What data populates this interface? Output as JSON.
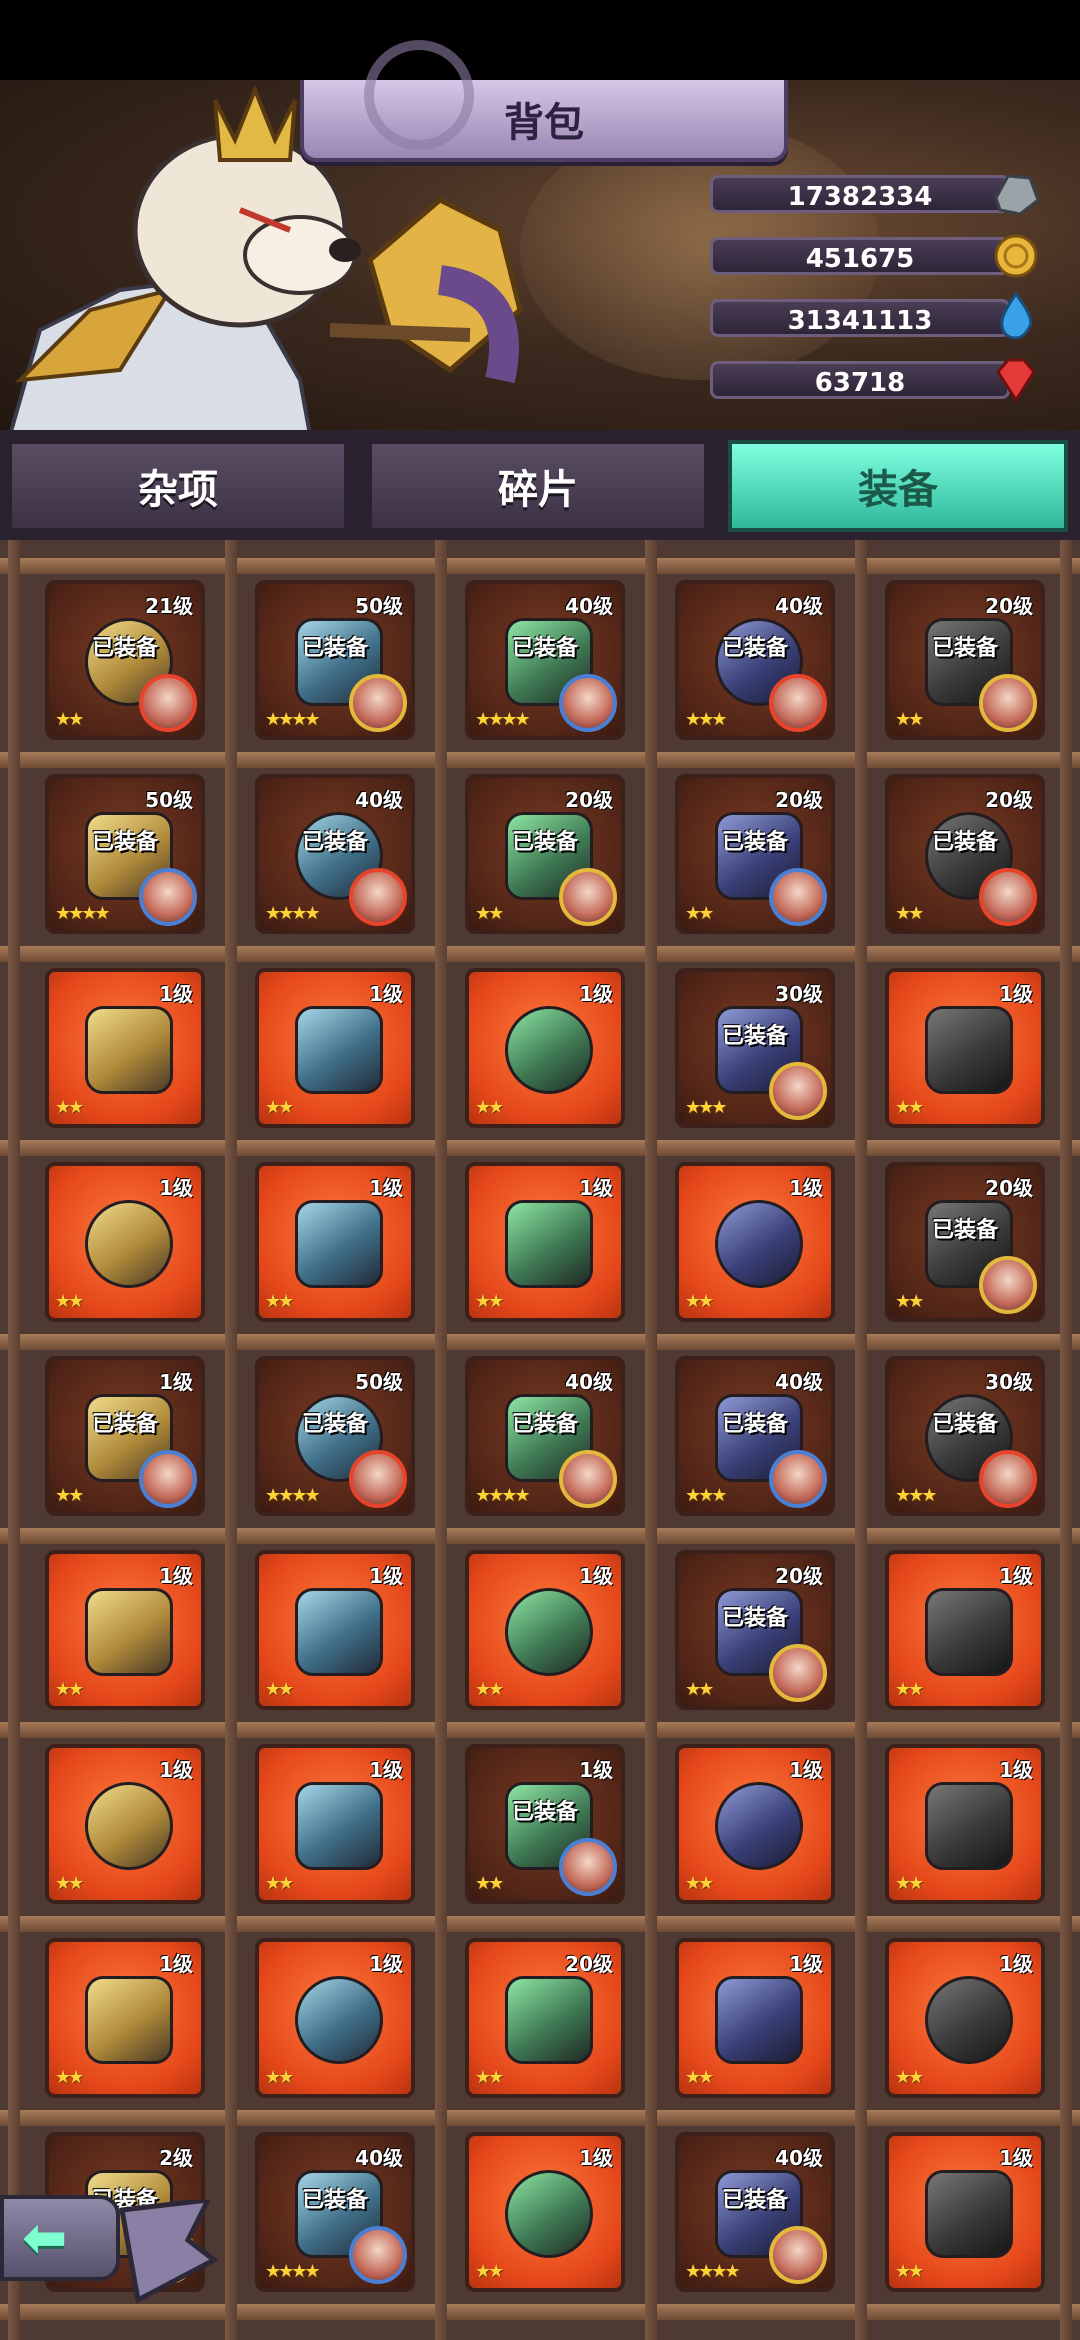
{
  "title": "背包",
  "resources": [
    {
      "value": "17382334",
      "icon": "ore-icon",
      "color": "#9aa3a8"
    },
    {
      "value": "451675",
      "icon": "gold-coin-icon",
      "color": "#e8b63a"
    },
    {
      "value": "31341113",
      "icon": "water-drop-icon",
      "color": "#3aa0e8"
    },
    {
      "value": "63718",
      "icon": "red-gem-icon",
      "color": "#e63a3a"
    }
  ],
  "tabs": [
    {
      "label": "杂项",
      "active": false
    },
    {
      "label": "碎片",
      "active": false
    },
    {
      "label": "装备",
      "active": true
    }
  ],
  "equipped_label": "已装备",
  "items": [
    {
      "level": "21级",
      "equipped": true,
      "stars": 2
    },
    {
      "level": "50级",
      "equipped": true,
      "stars": 4
    },
    {
      "level": "40级",
      "equipped": true,
      "stars": 4
    },
    {
      "level": "40级",
      "equipped": true,
      "stars": 3
    },
    {
      "level": "20级",
      "equipped": true,
      "stars": 2
    },
    {
      "level": "50级",
      "equipped": true,
      "stars": 4
    },
    {
      "level": "40级",
      "equipped": true,
      "stars": 4
    },
    {
      "level": "20级",
      "equipped": true,
      "stars": 2
    },
    {
      "level": "20级",
      "equipped": true,
      "stars": 2
    },
    {
      "level": "20级",
      "equipped": true,
      "stars": 2
    },
    {
      "level": "1级",
      "equipped": false,
      "stars": 2
    },
    {
      "level": "1级",
      "equipped": false,
      "stars": 2
    },
    {
      "level": "1级",
      "equipped": false,
      "stars": 2
    },
    {
      "level": "30级",
      "equipped": true,
      "stars": 3
    },
    {
      "level": "1级",
      "equipped": false,
      "stars": 2
    },
    {
      "level": "1级",
      "equipped": false,
      "stars": 2
    },
    {
      "level": "1级",
      "equipped": false,
      "stars": 2
    },
    {
      "level": "1级",
      "equipped": false,
      "stars": 2
    },
    {
      "level": "1级",
      "equipped": false,
      "stars": 2
    },
    {
      "level": "20级",
      "equipped": true,
      "stars": 2
    },
    {
      "level": "1级",
      "equipped": true,
      "stars": 2
    },
    {
      "level": "50级",
      "equipped": true,
      "stars": 4
    },
    {
      "level": "40级",
      "equipped": true,
      "stars": 4
    },
    {
      "level": "40级",
      "equipped": true,
      "stars": 3
    },
    {
      "level": "30级",
      "equipped": true,
      "stars": 3
    },
    {
      "level": "1级",
      "equipped": false,
      "stars": 2
    },
    {
      "level": "1级",
      "equipped": false,
      "stars": 2
    },
    {
      "level": "1级",
      "equipped": false,
      "stars": 2
    },
    {
      "level": "20级",
      "equipped": true,
      "stars": 2
    },
    {
      "level": "1级",
      "equipped": false,
      "stars": 2
    },
    {
      "level": "1级",
      "equipped": false,
      "stars": 2
    },
    {
      "level": "1级",
      "equipped": false,
      "stars": 2
    },
    {
      "level": "1级",
      "equipped": true,
      "stars": 2
    },
    {
      "level": "1级",
      "equipped": false,
      "stars": 2
    },
    {
      "level": "1级",
      "equipped": false,
      "stars": 2
    },
    {
      "level": "1级",
      "equipped": false,
      "stars": 2
    },
    {
      "level": "1级",
      "equipped": false,
      "stars": 2
    },
    {
      "level": "20级",
      "equipped": false,
      "stars": 2
    },
    {
      "level": "1级",
      "equipped": false,
      "stars": 2
    },
    {
      "level": "1级",
      "equipped": false,
      "stars": 2
    },
    {
      "level": "2级",
      "equipped": true,
      "stars": 2
    },
    {
      "level": "40级",
      "equipped": true,
      "stars": 4
    },
    {
      "level": "1级",
      "equipped": false,
      "stars": 2
    },
    {
      "level": "40级",
      "equipped": true,
      "stars": 4
    },
    {
      "level": "1级",
      "equipped": false,
      "stars": 2
    }
  ],
  "back_button_icon": "back-arrow-icon"
}
